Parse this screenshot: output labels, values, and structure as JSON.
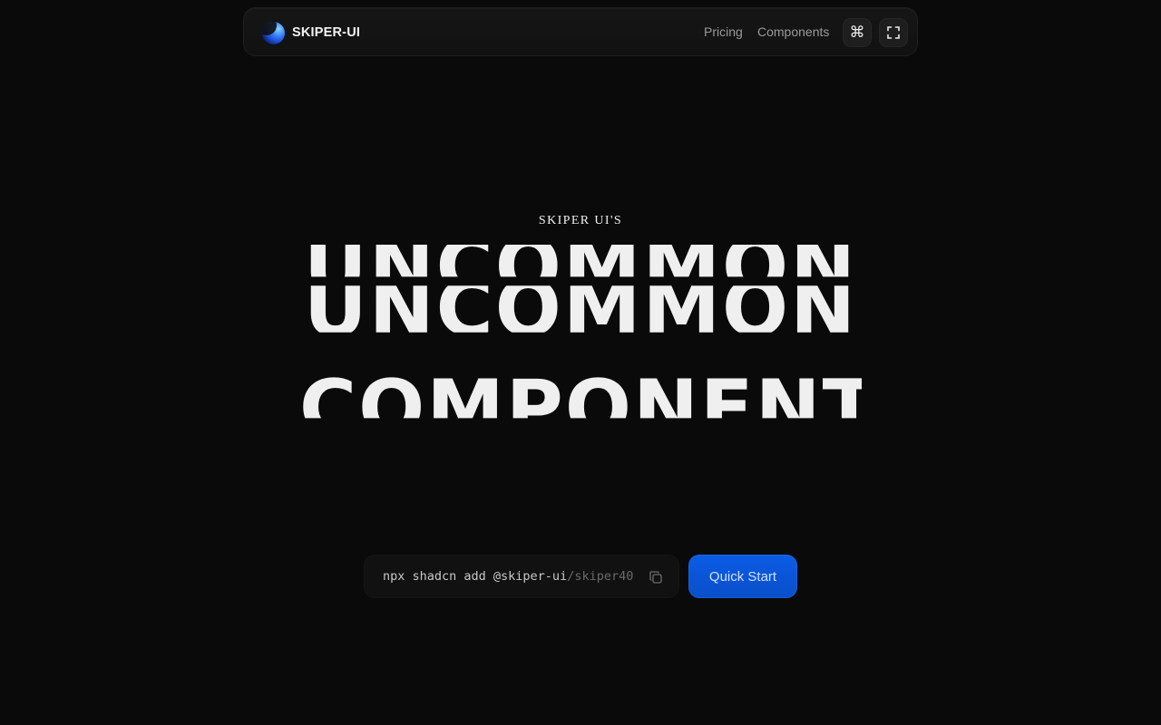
{
  "navbar": {
    "brand": "SKIPER-UI",
    "links": {
      "pricing": "Pricing",
      "components": "Components"
    },
    "icons": {
      "command": "command-icon",
      "fullscreen": "fullscreen-icon"
    }
  },
  "hero": {
    "eyebrow": "SKIPER UI'S",
    "lines": [
      "UNCOMMON",
      "UNCOMMON",
      "COMPONENTS"
    ]
  },
  "install": {
    "command": "npx shadcn add @skiper-ui",
    "suffix": "/skiper40",
    "copy_icon": "copy-icon",
    "button": "Quick Start"
  },
  "colors": {
    "background": "#0a0a0a",
    "accent": "#0a55d8",
    "text": "#efefef"
  }
}
